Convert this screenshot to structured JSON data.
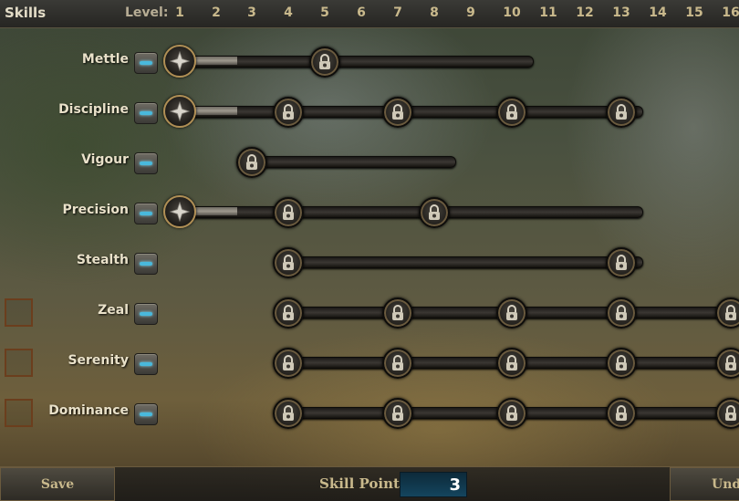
{
  "header": {
    "title": "Skills",
    "level_label": "Level:",
    "levels": [
      "1",
      "2",
      "3",
      "4",
      "5",
      "6",
      "7",
      "8",
      "9",
      "10",
      "11",
      "12",
      "13",
      "14",
      "15",
      "16"
    ]
  },
  "skills": [
    {
      "name": "Mettle",
      "has_checkbox": false,
      "minus_label": "decrease",
      "unlocked_level": 2,
      "locks": [
        5
      ],
      "track_end_level": 10
    },
    {
      "name": "Discipline",
      "has_checkbox": false,
      "minus_label": "decrease",
      "unlocked_level": 2,
      "locks": [
        4,
        7,
        10,
        13
      ],
      "track_end_level": 13
    },
    {
      "name": "Vigour",
      "has_checkbox": false,
      "minus_label": "decrease",
      "unlocked_level": 0,
      "locks": [
        3
      ],
      "track_end_level": 8
    },
    {
      "name": "Precision",
      "has_checkbox": false,
      "minus_label": "decrease",
      "unlocked_level": 2,
      "locks": [
        4,
        8
      ],
      "track_end_level": 13
    },
    {
      "name": "Stealth",
      "has_checkbox": false,
      "minus_label": "decrease",
      "unlocked_level": 0,
      "locks": [
        4,
        13
      ],
      "track_end_level": 13
    },
    {
      "name": "Zeal",
      "has_checkbox": true,
      "minus_label": "decrease",
      "unlocked_level": 0,
      "locks": [
        4,
        7,
        10,
        13,
        16
      ],
      "track_end_level": 16
    },
    {
      "name": "Serenity",
      "has_checkbox": true,
      "minus_label": "decrease",
      "unlocked_level": 0,
      "locks": [
        4,
        7,
        10,
        13,
        16
      ],
      "track_end_level": 16
    },
    {
      "name": "Dominance",
      "has_checkbox": true,
      "minus_label": "decrease",
      "unlocked_level": 0,
      "locks": [
        4,
        7,
        10,
        13,
        16
      ],
      "track_end_level": 16
    }
  ],
  "footer": {
    "save_label": "Save",
    "skill_points_label": "Skill Points",
    "skill_points_value": "3",
    "undo_label": "Undo"
  },
  "colors": {
    "accent_blue": "#49b9dc",
    "gold_text": "#c9b98c",
    "checkbox_border": "#6b3e1d"
  }
}
